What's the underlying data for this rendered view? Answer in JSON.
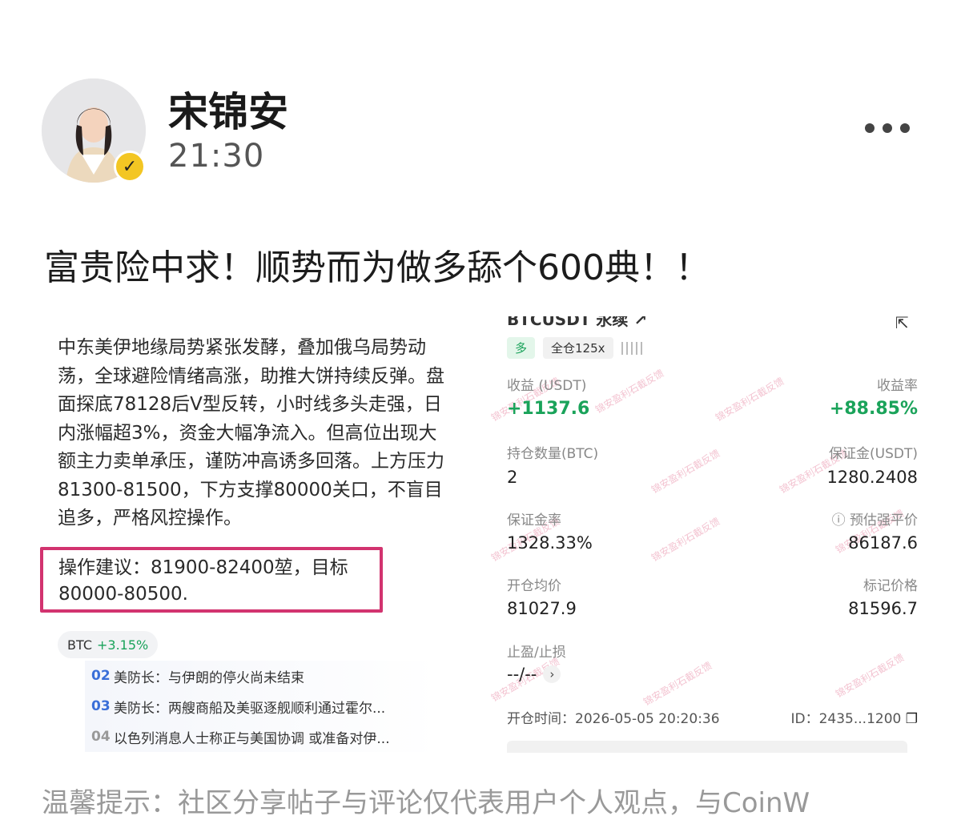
{
  "post": {
    "username": "宋锦安",
    "time": "21:30",
    "more_icon": "more-horizontal-icon",
    "verified_icon": "verified-badge-icon",
    "headline": "富贵险中求！顺势而为做多舔个600典！！"
  },
  "left_image": {
    "analysis": "中东美伊地缘局势紧张发酵，叠加俄乌局势动荡，全球避险情绪高涨，助推大饼持续反弹。盘面探底78128后V型反转，小时线多头走强，日内涨幅超3%，资金大幅净流入。但高位出现大额主力卖单承压，谨防冲高诱多回落。上方压力81300-81500，下方支撑80000关口，不盲目追多，严格风控操作。",
    "advice_line1": "操作建议：81900-82400堃，目标",
    "advice_line2": "80000-80500.",
    "btc_label": "BTC",
    "btc_change": "+3.15%",
    "news": [
      {
        "num": "02",
        "text": "美防长：与伊朗的停火尚未结束"
      },
      {
        "num": "03",
        "text": "美防长：两艘商船及美驱逐舰顺利通过霍尔..."
      },
      {
        "num": "04",
        "text": "以色列消息人士称正与美国协调 或准备对伊..."
      }
    ]
  },
  "position_card": {
    "title": "BTCUSDT 永续 ↗",
    "side_tag": "多",
    "margin_tag": "全仓125x",
    "pnl_label": "收益 (USDT)",
    "pnl_value": "+1137.6",
    "roe_label": "收益率",
    "roe_value": "+88.85%",
    "qty_label": "持仓数量(BTC)",
    "qty_value": "2",
    "margin_label": "保证金(USDT)",
    "margin_value": "1280.2408",
    "margin_rate_label": "保证金率",
    "margin_rate_value": "1328.33%",
    "liq_label": "ⓘ 预估强平价",
    "liq_value": "86187.6",
    "entry_label": "开仓均价",
    "entry_value": "81027.9",
    "mark_label": "标记价格",
    "mark_value": "81596.7",
    "tpsl_label": "止盈/止损",
    "tpsl_value": "--/--",
    "open_time": "开仓时间：2026-05-05 20:20:36",
    "id_text": "ID：2435...1200",
    "watermark": "锦安盈利石截反馈"
  },
  "footer": {
    "text": "温馨提示：社区分享帖子与评论仅代表用户个人观点，与CoinW"
  },
  "colors": {
    "accent_green": "#1aa35a",
    "highlight_border": "#d2336f",
    "verify_badge": "#f3c623"
  }
}
